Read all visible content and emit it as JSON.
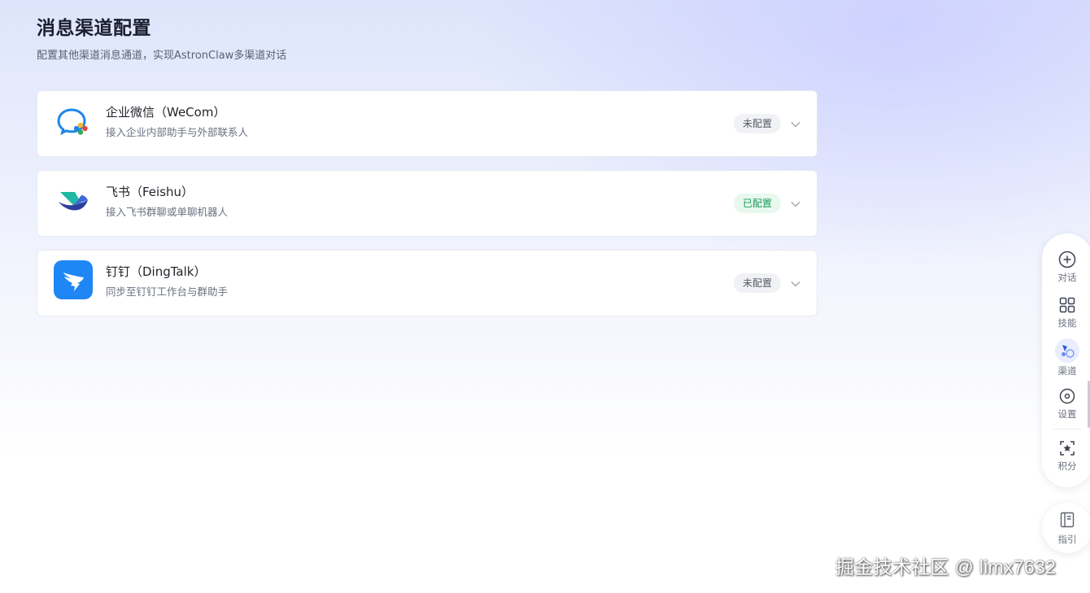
{
  "page": {
    "title": "消息渠道配置",
    "subtitle": "配置其他渠道消息通道，实现AstronClaw多渠道对话"
  },
  "channels": [
    {
      "name": "企业微信（WeCom）",
      "description": "接入企业内部助手与外部联系人",
      "status": "未配置",
      "icon": "wecom-logo-icon"
    },
    {
      "name": "飞书（Feishu）",
      "description": "接入飞书群聊或单聊机器人",
      "status": "已配置",
      "icon": "feishu-logo-icon"
    },
    {
      "name": "钉钉（DingTalk）",
      "description": "同步至钉钉工作台与群助手",
      "status": "未配置",
      "icon": "dingtalk-logo-icon"
    }
  ],
  "dock": {
    "items": [
      {
        "label": "对话",
        "icon": "plus-circle-icon"
      },
      {
        "label": "技能",
        "icon": "grid-icon"
      },
      {
        "label": "渠道",
        "icon": "channel-icon",
        "active": true
      },
      {
        "label": "设置",
        "icon": "settings-icon"
      },
      {
        "label": "积分",
        "icon": "star-icon"
      }
    ],
    "guide": {
      "label": "指引",
      "icon": "book-icon"
    }
  },
  "colors": {
    "configured": "#1a9a5a",
    "not_configured": "#555a66",
    "dingtalk_blue": "#1f86f5",
    "feishu_dark": "#2d3e9c",
    "feishu_teal": "#1fb8a3"
  },
  "watermark": "掘金技术社区 @ limx7632"
}
